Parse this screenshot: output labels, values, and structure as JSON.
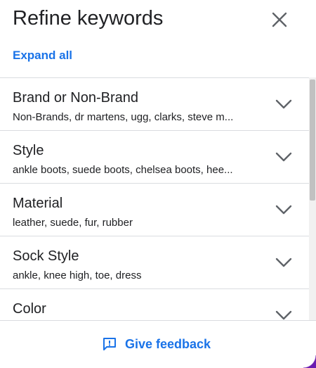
{
  "panel": {
    "title": "Refine keywords",
    "expand_all_label": "Expand all",
    "close_icon": "close-icon"
  },
  "items": [
    {
      "title": "Brand or Non-Brand",
      "subtitle": "Non-Brands, dr martens, ugg, clarks, steve m..."
    },
    {
      "title": "Style",
      "subtitle": "ankle boots, suede boots, chelsea boots, hee..."
    },
    {
      "title": "Material",
      "subtitle": "leather, suede, fur, rubber"
    },
    {
      "title": "Sock Style",
      "subtitle": "ankle, knee high, toe, dress"
    },
    {
      "title": "Color",
      "subtitle": ""
    }
  ],
  "footer": {
    "feedback_label": "Give feedback",
    "feedback_icon": "feedback-icon"
  },
  "colors": {
    "accent": "#1a73e8",
    "text": "#202124",
    "divider": "#dadce0",
    "icon": "#5f6368"
  }
}
